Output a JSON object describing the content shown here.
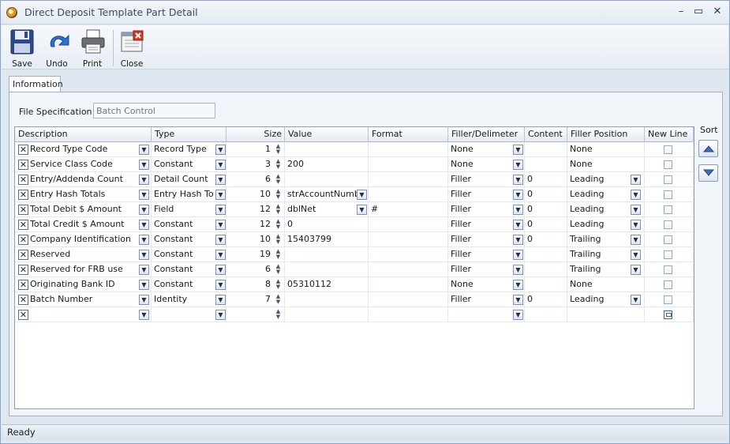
{
  "window": {
    "title": "Direct Deposit Template Part Detail",
    "minimize": "–",
    "maximize": "▭",
    "close": "✕"
  },
  "toolbar": {
    "save": "Save",
    "undo": "Undo",
    "print": "Print",
    "close": "Close"
  },
  "tabs": [
    {
      "label": "Information"
    }
  ],
  "file_spec": {
    "label": "File Specification",
    "value": "Batch Control"
  },
  "grid": {
    "columns": [
      "Description",
      "Type",
      "Size",
      "Value",
      "Format",
      "Filler/Delimeter",
      "Content",
      "Filler Position",
      "New Line"
    ],
    "rows": [
      {
        "description": "Record Type Code",
        "type": "Record Type",
        "size": "1",
        "value": "",
        "value_dd": false,
        "format": "",
        "filler": "None",
        "content": "",
        "position": "None",
        "position_dd": false
      },
      {
        "description": "Service Class Code",
        "type": "Constant",
        "size": "3",
        "value": "200",
        "value_dd": false,
        "format": "",
        "filler": "None",
        "content": "",
        "position": "None",
        "position_dd": false
      },
      {
        "description": "Entry/Addenda Count",
        "type": "Detail Count",
        "size": "6",
        "value": "",
        "value_dd": false,
        "format": "",
        "filler": "Filler",
        "content": "0",
        "position": "Leading",
        "position_dd": true
      },
      {
        "description": "Entry Hash Totals",
        "type": "Entry Hash Tota",
        "size": "10",
        "value": "strAccountNumber",
        "value_dd": true,
        "format": "",
        "filler": "Filler",
        "content": "0",
        "position": "Leading",
        "position_dd": true
      },
      {
        "description": "Total Debit $ Amount",
        "type": "Field",
        "size": "12",
        "value": "dblNet",
        "value_dd": true,
        "format": "#",
        "filler": "Filler",
        "content": "0",
        "position": "Leading",
        "position_dd": true
      },
      {
        "description": "Total Credit $ Amount",
        "type": "Constant",
        "size": "12",
        "value": "0",
        "value_dd": false,
        "format": "",
        "filler": "Filler",
        "content": "0",
        "position": "Leading",
        "position_dd": true
      },
      {
        "description": "Company Identification",
        "type": "Constant",
        "size": "10",
        "value": "15403799",
        "value_dd": false,
        "format": "",
        "filler": "Filler",
        "content": "0",
        "position": "Trailing",
        "position_dd": true
      },
      {
        "description": "Reserved",
        "type": "Constant",
        "size": "19",
        "value": "",
        "value_dd": false,
        "format": "",
        "filler": "Filler",
        "content": "",
        "position": "Trailing",
        "position_dd": true
      },
      {
        "description": "Reserved for FRB use",
        "type": "Constant",
        "size": "6",
        "value": "",
        "value_dd": false,
        "format": "",
        "filler": "Filler",
        "content": "",
        "position": "Trailing",
        "position_dd": true
      },
      {
        "description": "Originating Bank ID",
        "type": "Constant",
        "size": "8",
        "value": "05310112",
        "value_dd": false,
        "format": "",
        "filler": "None",
        "content": "",
        "position": "None",
        "position_dd": false
      },
      {
        "description": "Batch Number",
        "type": "Identity",
        "size": "7",
        "value": "",
        "value_dd": false,
        "format": "",
        "filler": "Filler",
        "content": "0",
        "position": "Leading",
        "position_dd": true
      },
      {
        "description": "",
        "type": "",
        "size": "",
        "value": "",
        "value_dd": false,
        "format": "",
        "filler": "",
        "content": "",
        "position": "",
        "position_dd": false,
        "is_new": true
      }
    ]
  },
  "sort": {
    "label": "Sort"
  },
  "status": {
    "text": "Ready"
  },
  "icons": {
    "remove": "✕",
    "dropdown": "▼",
    "spin_up": "▲",
    "spin_down": "▼"
  }
}
